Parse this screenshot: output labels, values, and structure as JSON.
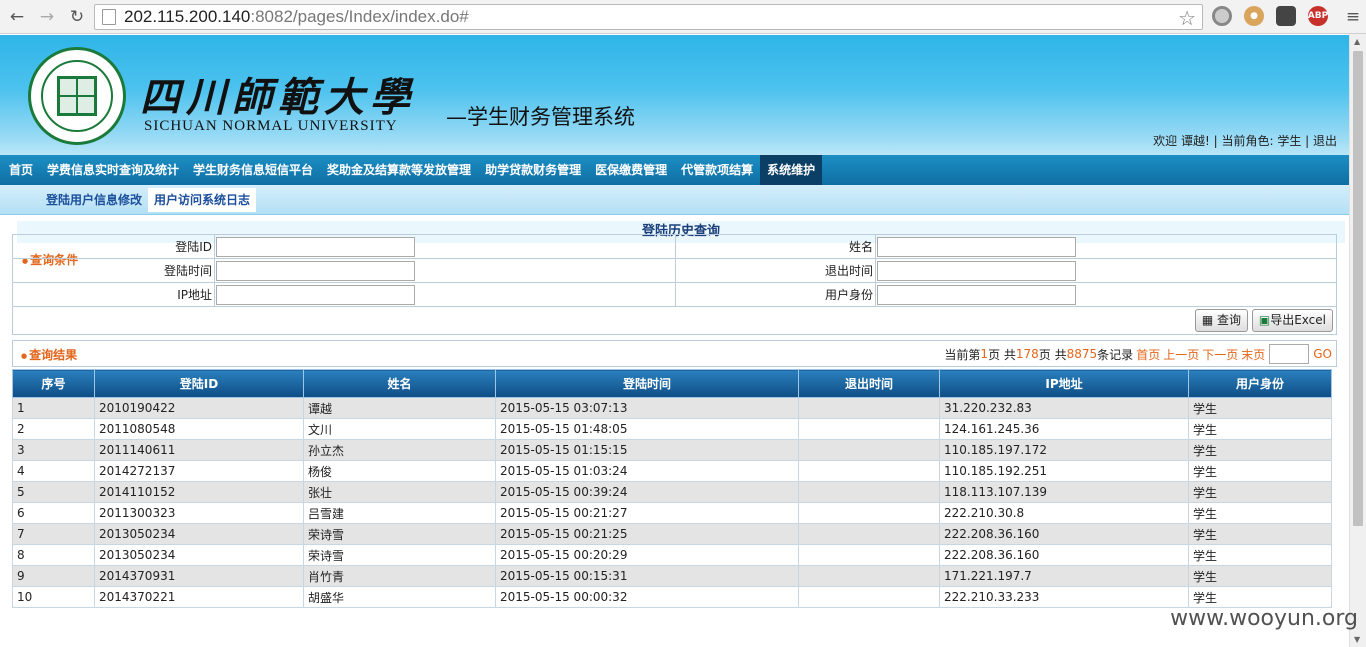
{
  "browser": {
    "url_host": "202.115.200.140",
    "url_port": ":8082",
    "url_path": "/pages/Index/index.do#",
    "ext_abp": "ABP"
  },
  "header": {
    "university_cn": "四川師範大學",
    "university_en": "SICHUAN NORMAL UNIVERSITY",
    "system_title": "—学生财务管理系统",
    "welcome": "欢迎 谭越! | 当前角色: 学生 | 退出"
  },
  "menu": {
    "items": [
      "首页",
      "学费信息实时查询及统计",
      "学生财务信息短信平台",
      "奖助金及结算款等发放管理",
      "助学贷款财务管理",
      "医保缴费管理",
      "代管款项结算",
      "系统维护"
    ],
    "active_index": 7
  },
  "submenu": {
    "items": [
      "登陆用户信息修改",
      "用户访问系统日志"
    ],
    "active_index": 1
  },
  "section_title": "登陆历史查询",
  "query": {
    "title": "查询条件",
    "login_id_label": "登陆ID",
    "name_label": "姓名",
    "login_time_label": "登陆时间",
    "logout_time_label": "退出时间",
    "ip_label": "IP地址",
    "identity_label": "用户身份",
    "search_button": "查询",
    "export_button": "导出Excel"
  },
  "results": {
    "title": "查询结果",
    "pager_prefix": "当前第",
    "current_page": "1",
    "pager_mid1": "页 共",
    "total_pages": "178",
    "pager_mid2": "页 共",
    "total_records": "8875",
    "pager_suffix": "条记录",
    "first": "首页",
    "prev": "上一页",
    "next": "下一页",
    "last": "末页",
    "go": "GO",
    "columns": [
      "序号",
      "登陆ID",
      "姓名",
      "登陆时间",
      "退出时间",
      "IP地址",
      "用户身份"
    ],
    "rows": [
      [
        "1",
        "2010190422",
        "谭越",
        "2015-05-15 03:07:13",
        "",
        "31.220.232.83",
        "学生"
      ],
      [
        "2",
        "2011080548",
        "文川",
        "2015-05-15 01:48:05",
        "",
        "124.161.245.36",
        "学生"
      ],
      [
        "3",
        "2011140611",
        "孙立杰",
        "2015-05-15 01:15:15",
        "",
        "110.185.197.172",
        "学生"
      ],
      [
        "4",
        "2014272137",
        "杨俊",
        "2015-05-15 01:03:24",
        "",
        "110.185.192.251",
        "学生"
      ],
      [
        "5",
        "2014110152",
        "张壮",
        "2015-05-15 00:39:24",
        "",
        "118.113.107.139",
        "学生"
      ],
      [
        "6",
        "2011300323",
        "吕雪建",
        "2015-05-15 00:21:27",
        "",
        "222.210.30.8",
        "学生"
      ],
      [
        "7",
        "2013050234",
        "荣诗雪",
        "2015-05-15 00:21:25",
        "",
        "222.208.36.160",
        "学生"
      ],
      [
        "8",
        "2013050234",
        "荣诗雪",
        "2015-05-15 00:20:29",
        "",
        "222.208.36.160",
        "学生"
      ],
      [
        "9",
        "2014370931",
        "肖竹青",
        "2015-05-15 00:15:31",
        "",
        "171.221.197.7",
        "学生"
      ],
      [
        "10",
        "2014370221",
        "胡盛华",
        "2015-05-15 00:00:32",
        "",
        "222.210.33.233",
        "学生"
      ]
    ]
  },
  "watermark": "www.wooyun.org"
}
